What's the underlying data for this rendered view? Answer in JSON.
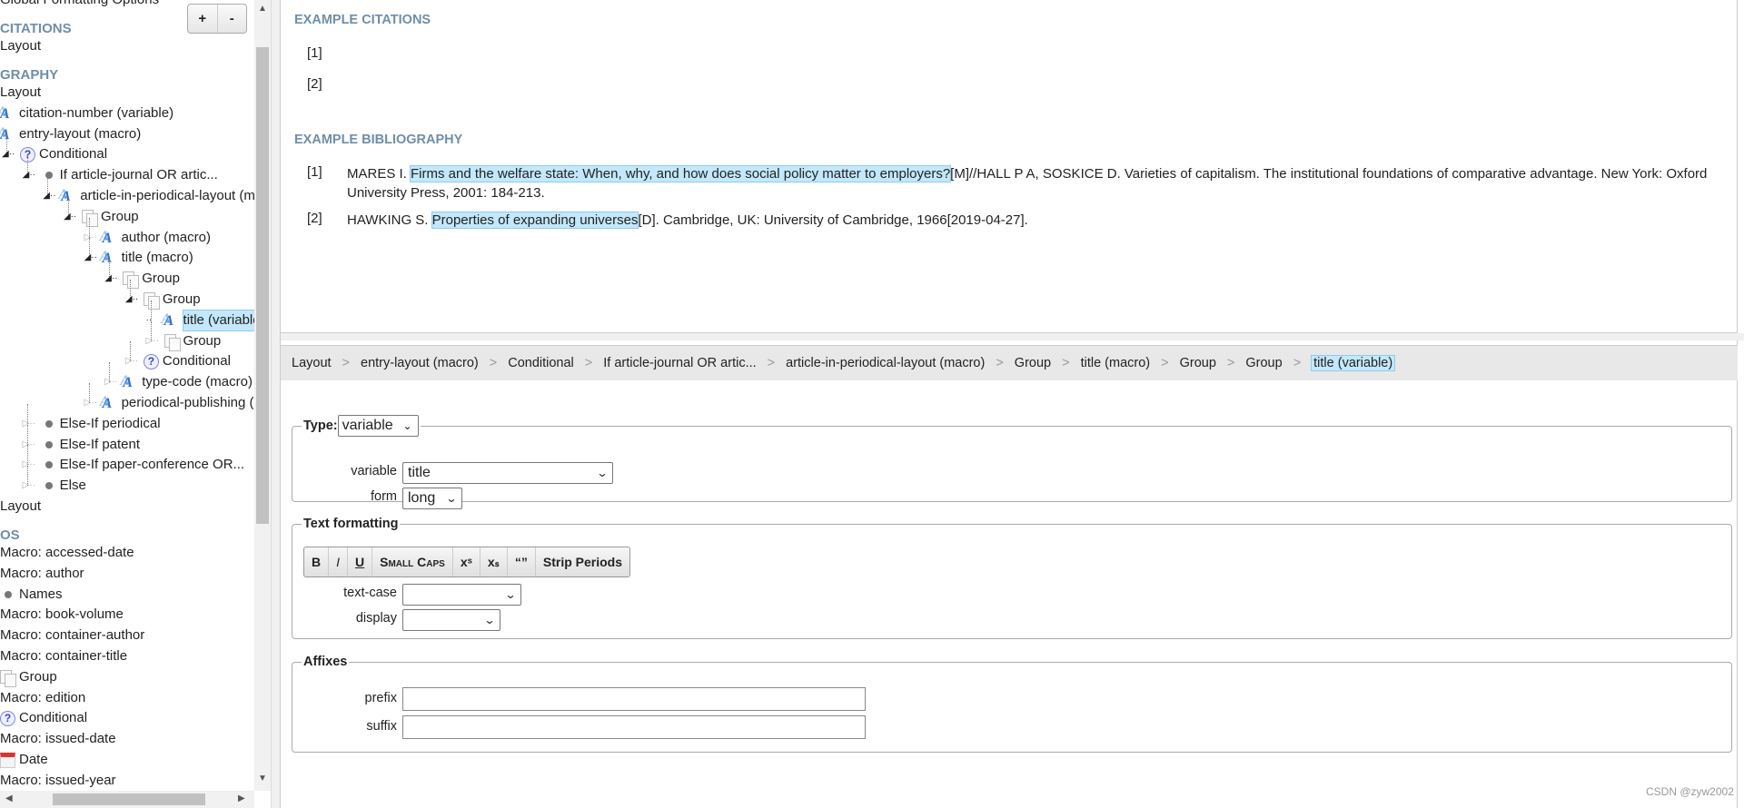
{
  "sidebar": {
    "zoom_in_label": "+",
    "zoom_out_label": "-",
    "rows": [
      {
        "kind": "text",
        "label": "Global Formatting Options"
      },
      {
        "kind": "header",
        "label": "CITATIONS"
      },
      {
        "kind": "text",
        "label": "Layout"
      },
      {
        "kind": "header",
        "label": "GRAPHY"
      },
      {
        "kind": "text",
        "label": "Layout"
      },
      {
        "kind": "node",
        "level": -1,
        "icon": "macro",
        "expander": "none",
        "label": "citation-number (variable)"
      },
      {
        "kind": "node",
        "level": -1,
        "icon": "macro",
        "expander": "none",
        "label": "entry-layout (macro)"
      },
      {
        "kind": "node",
        "level": 0,
        "icon": "cond",
        "expander": "open",
        "label": "Conditional"
      },
      {
        "kind": "node",
        "level": 1,
        "icon": "bullet",
        "expander": "open",
        "label": "If article-journal OR artic..."
      },
      {
        "kind": "node",
        "level": 2,
        "icon": "macro",
        "expander": "open",
        "label": "article-in-periodical-layout (macro)"
      },
      {
        "kind": "node",
        "level": 3,
        "icon": "group",
        "expander": "open",
        "label": "Group"
      },
      {
        "kind": "node",
        "level": 4,
        "icon": "macro",
        "expander": "closed",
        "label": "author (macro)"
      },
      {
        "kind": "node",
        "level": 4,
        "icon": "macro",
        "expander": "open",
        "label": "title (macro)"
      },
      {
        "kind": "node",
        "level": 5,
        "icon": "group",
        "expander": "open",
        "label": "Group"
      },
      {
        "kind": "node",
        "level": 6,
        "icon": "group",
        "expander": "open",
        "label": "Group"
      },
      {
        "kind": "node",
        "level": 7,
        "icon": "macro",
        "expander": "leaf",
        "label": "title (variable)",
        "selected": true
      },
      {
        "kind": "node",
        "level": 7,
        "icon": "group",
        "expander": "closed",
        "label": "Group"
      },
      {
        "kind": "node",
        "level": 6,
        "icon": "cond",
        "expander": "closed",
        "label": "Conditional"
      },
      {
        "kind": "node",
        "level": 5,
        "icon": "macro",
        "expander": "closed",
        "label": "type-code (macro)"
      },
      {
        "kind": "node",
        "level": 4,
        "icon": "macro",
        "expander": "closed",
        "label": "periodical-publishing (macro)"
      },
      {
        "kind": "node",
        "level": 1,
        "icon": "bullet",
        "expander": "closed",
        "label": "Else-If periodical"
      },
      {
        "kind": "node",
        "level": 1,
        "icon": "bullet",
        "expander": "closed",
        "label": "Else-If patent"
      },
      {
        "kind": "node",
        "level": 1,
        "icon": "bullet",
        "expander": "closed",
        "label": "Else-If paper-conference OR..."
      },
      {
        "kind": "node",
        "level": 1,
        "icon": "bullet",
        "expander": "closed",
        "label": "Else"
      },
      {
        "kind": "text",
        "label": "Layout"
      },
      {
        "kind": "header",
        "label": "OS"
      },
      {
        "kind": "text",
        "label": "Macro: accessed-date"
      },
      {
        "kind": "text",
        "label": "Macro: author"
      },
      {
        "kind": "node",
        "level": -1,
        "icon": "bullet",
        "expander": "none",
        "label": "Names"
      },
      {
        "kind": "text",
        "label": "Macro: book-volume"
      },
      {
        "kind": "text",
        "label": "Macro: container-author"
      },
      {
        "kind": "text",
        "label": "Macro: container-title"
      },
      {
        "kind": "node",
        "level": -1,
        "icon": "group",
        "expander": "none",
        "label": "Group"
      },
      {
        "kind": "text",
        "label": "Macro: edition"
      },
      {
        "kind": "node",
        "level": -1,
        "icon": "cond",
        "expander": "none",
        "label": "Conditional"
      },
      {
        "kind": "text",
        "label": "Macro: issued-date"
      },
      {
        "kind": "node",
        "level": -1,
        "icon": "date",
        "expander": "none",
        "label": "Date"
      },
      {
        "kind": "text",
        "label": "Macro: issued-year"
      }
    ]
  },
  "preview": {
    "citations_heading": "EXAMPLE CITATIONS",
    "citations": [
      "[1]",
      "[2]"
    ],
    "bibliography_heading": "EXAMPLE BIBLIOGRAPHY",
    "bibliography": [
      {
        "num": "[1]",
        "pre": "MARES I. ",
        "title": "Firms and the welfare state: When, why, and how does social policy matter to employers?",
        "post": "[M]//HALL P A, SOSKICE D. Varieties of capitalism. The institutional foundations of comparative advantage. New York: Oxford University Press, 2001: 184-213."
      },
      {
        "num": "[2]",
        "pre": "HAWKING S. ",
        "title": "Properties of expanding universes",
        "post": "[D]. Cambridge, UK: University of Cambridge, 1966[2019-04-27]."
      }
    ]
  },
  "breadcrumb": [
    "Layout",
    "entry-layout (macro)",
    "Conditional",
    "If article-journal OR artic...",
    "article-in-periodical-layout (macro)",
    "Group",
    "title (macro)",
    "Group",
    "Group",
    "title (variable)"
  ],
  "breadcrumb_separator": ">",
  "type_section": {
    "legend": "Type:",
    "type_value": "variable",
    "variable_label": "variable",
    "variable_value": "title",
    "form_label": "form",
    "form_value": "long"
  },
  "text_formatting": {
    "legend": "Text formatting",
    "buttons": [
      "B",
      "I",
      "U",
      "Small Caps",
      "xˢ",
      "xₛ",
      "“”",
      "Strip Periods"
    ],
    "text_case_label": "text-case",
    "text_case_value": "",
    "display_label": "display",
    "display_value": ""
  },
  "affixes": {
    "legend": "Affixes",
    "prefix_label": "prefix",
    "prefix_value": "",
    "suffix_label": "suffix",
    "suffix_value": ""
  },
  "watermark": "CSDN @zyw2002",
  "colors": {
    "heading": "#6f8ea8",
    "highlight": "#c3e8fb",
    "highlight_border": "#8ccdf0"
  }
}
